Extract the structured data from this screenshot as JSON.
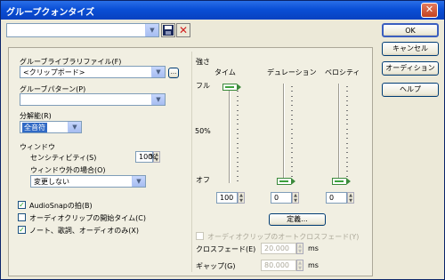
{
  "window": {
    "title": "グループクォンタイズ"
  },
  "toolbar": {
    "preset_value": "",
    "save_icon": "save-disk-icon",
    "delete_icon": "red-x-icon"
  },
  "buttons": {
    "ok": "OK",
    "cancel": "キャンセル",
    "audition": "オーディション",
    "help": "ヘルプ"
  },
  "groove": {
    "file_label": "グルーブライブラリファイル(F)",
    "file_value": "<クリップボード>",
    "browse_label": "...",
    "pattern_label": "グルーブパターン(P)",
    "pattern_value": "",
    "resolution_label": "分解能(R)",
    "resolution_value": "全音符"
  },
  "window_section": {
    "label": "ウィンドウ",
    "sensitivity_label": "センシティビティ(S)",
    "sensitivity_value": "100",
    "sensitivity_unit": "%",
    "outside_label": "ウィンドウ外の場合(O)",
    "outside_value": "変更しない"
  },
  "options": [
    {
      "label": "AudioSnapの拍(B)",
      "checked": true
    },
    {
      "label": "オーディオクリップの開始タイム(C)",
      "checked": false
    },
    {
      "label": "ノート、歌詞、オーディオのみ(X)",
      "checked": true
    }
  ],
  "strength": {
    "label": "強さ",
    "scale": {
      "top": "フル",
      "mid": "50%",
      "bottom": "オフ"
    },
    "columns": [
      {
        "label": "タイム",
        "value": "100",
        "level": 1.0
      },
      {
        "label": "デュレーション",
        "value": "0",
        "level": 0.0
      },
      {
        "label": "ベロシティ",
        "value": "0",
        "level": 0.0
      }
    ],
    "define_button": "定義..."
  },
  "crossfade": {
    "auto_label": "オーディオクリップのオートクロスフェード(Y)",
    "auto_checked": false,
    "crossfade_label": "クロスフェード(E)",
    "crossfade_value": "20.000",
    "gap_label": "ギャップ(G)",
    "gap_value": "80.000",
    "unit": "ms"
  }
}
